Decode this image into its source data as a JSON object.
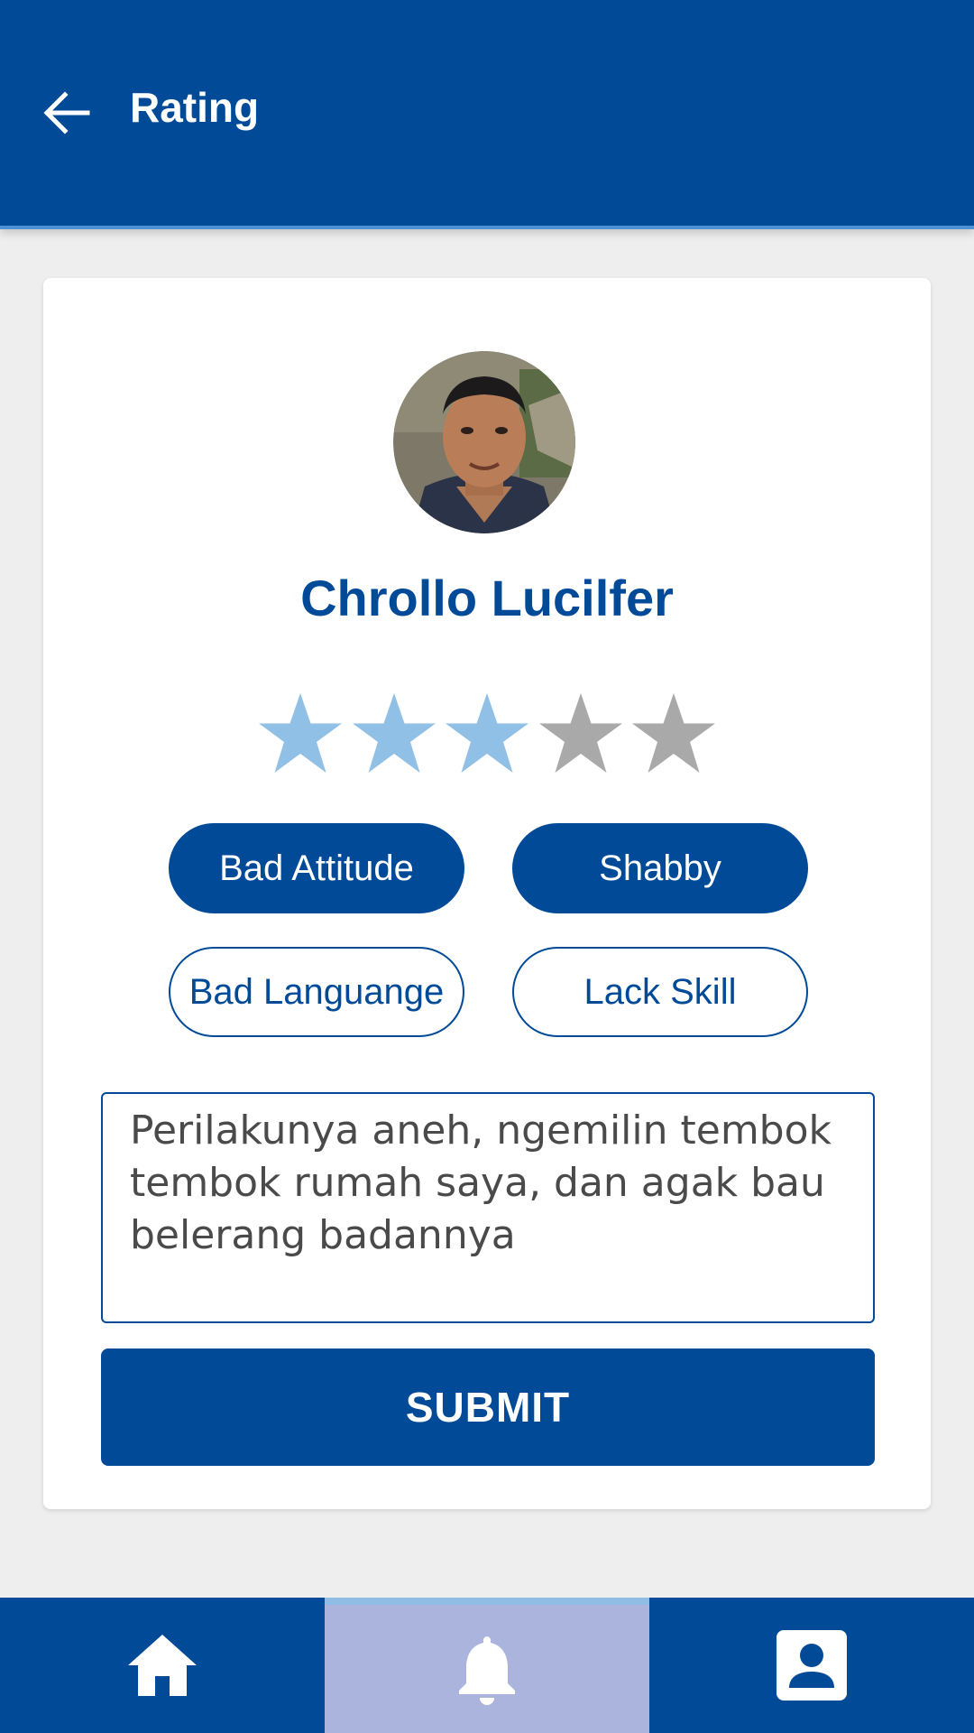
{
  "app_bar": {
    "title": "Rating",
    "back_icon": "arrow-back-icon"
  },
  "profile": {
    "name": "Chrollo Lucilfer",
    "avatar_icon": "user-photo"
  },
  "rating": {
    "value": 3,
    "max": 5,
    "active_color": "#90c0e6",
    "inactive_color": "#a9a9a9"
  },
  "tags": [
    {
      "label": "Bad Attitude",
      "selected": true
    },
    {
      "label": "Shabby",
      "selected": true
    },
    {
      "label": "Bad Languange",
      "selected": false
    },
    {
      "label": "Lack Skill",
      "selected": false
    }
  ],
  "comment": {
    "value": "Perilakunya aneh, ngemilin tembok tembok rumah saya, dan agak bau belerang badannya"
  },
  "submit": {
    "label": "SUBMIT"
  },
  "bottom_nav": [
    {
      "icon": "home-icon",
      "active": false
    },
    {
      "icon": "bell-icon",
      "active": true
    },
    {
      "icon": "account-box-icon",
      "active": false
    }
  ],
  "colors": {
    "primary": "#014a98",
    "accent_line": "#4e92d6",
    "nav_active": "#aab4dc",
    "background": "#eeeeee"
  }
}
